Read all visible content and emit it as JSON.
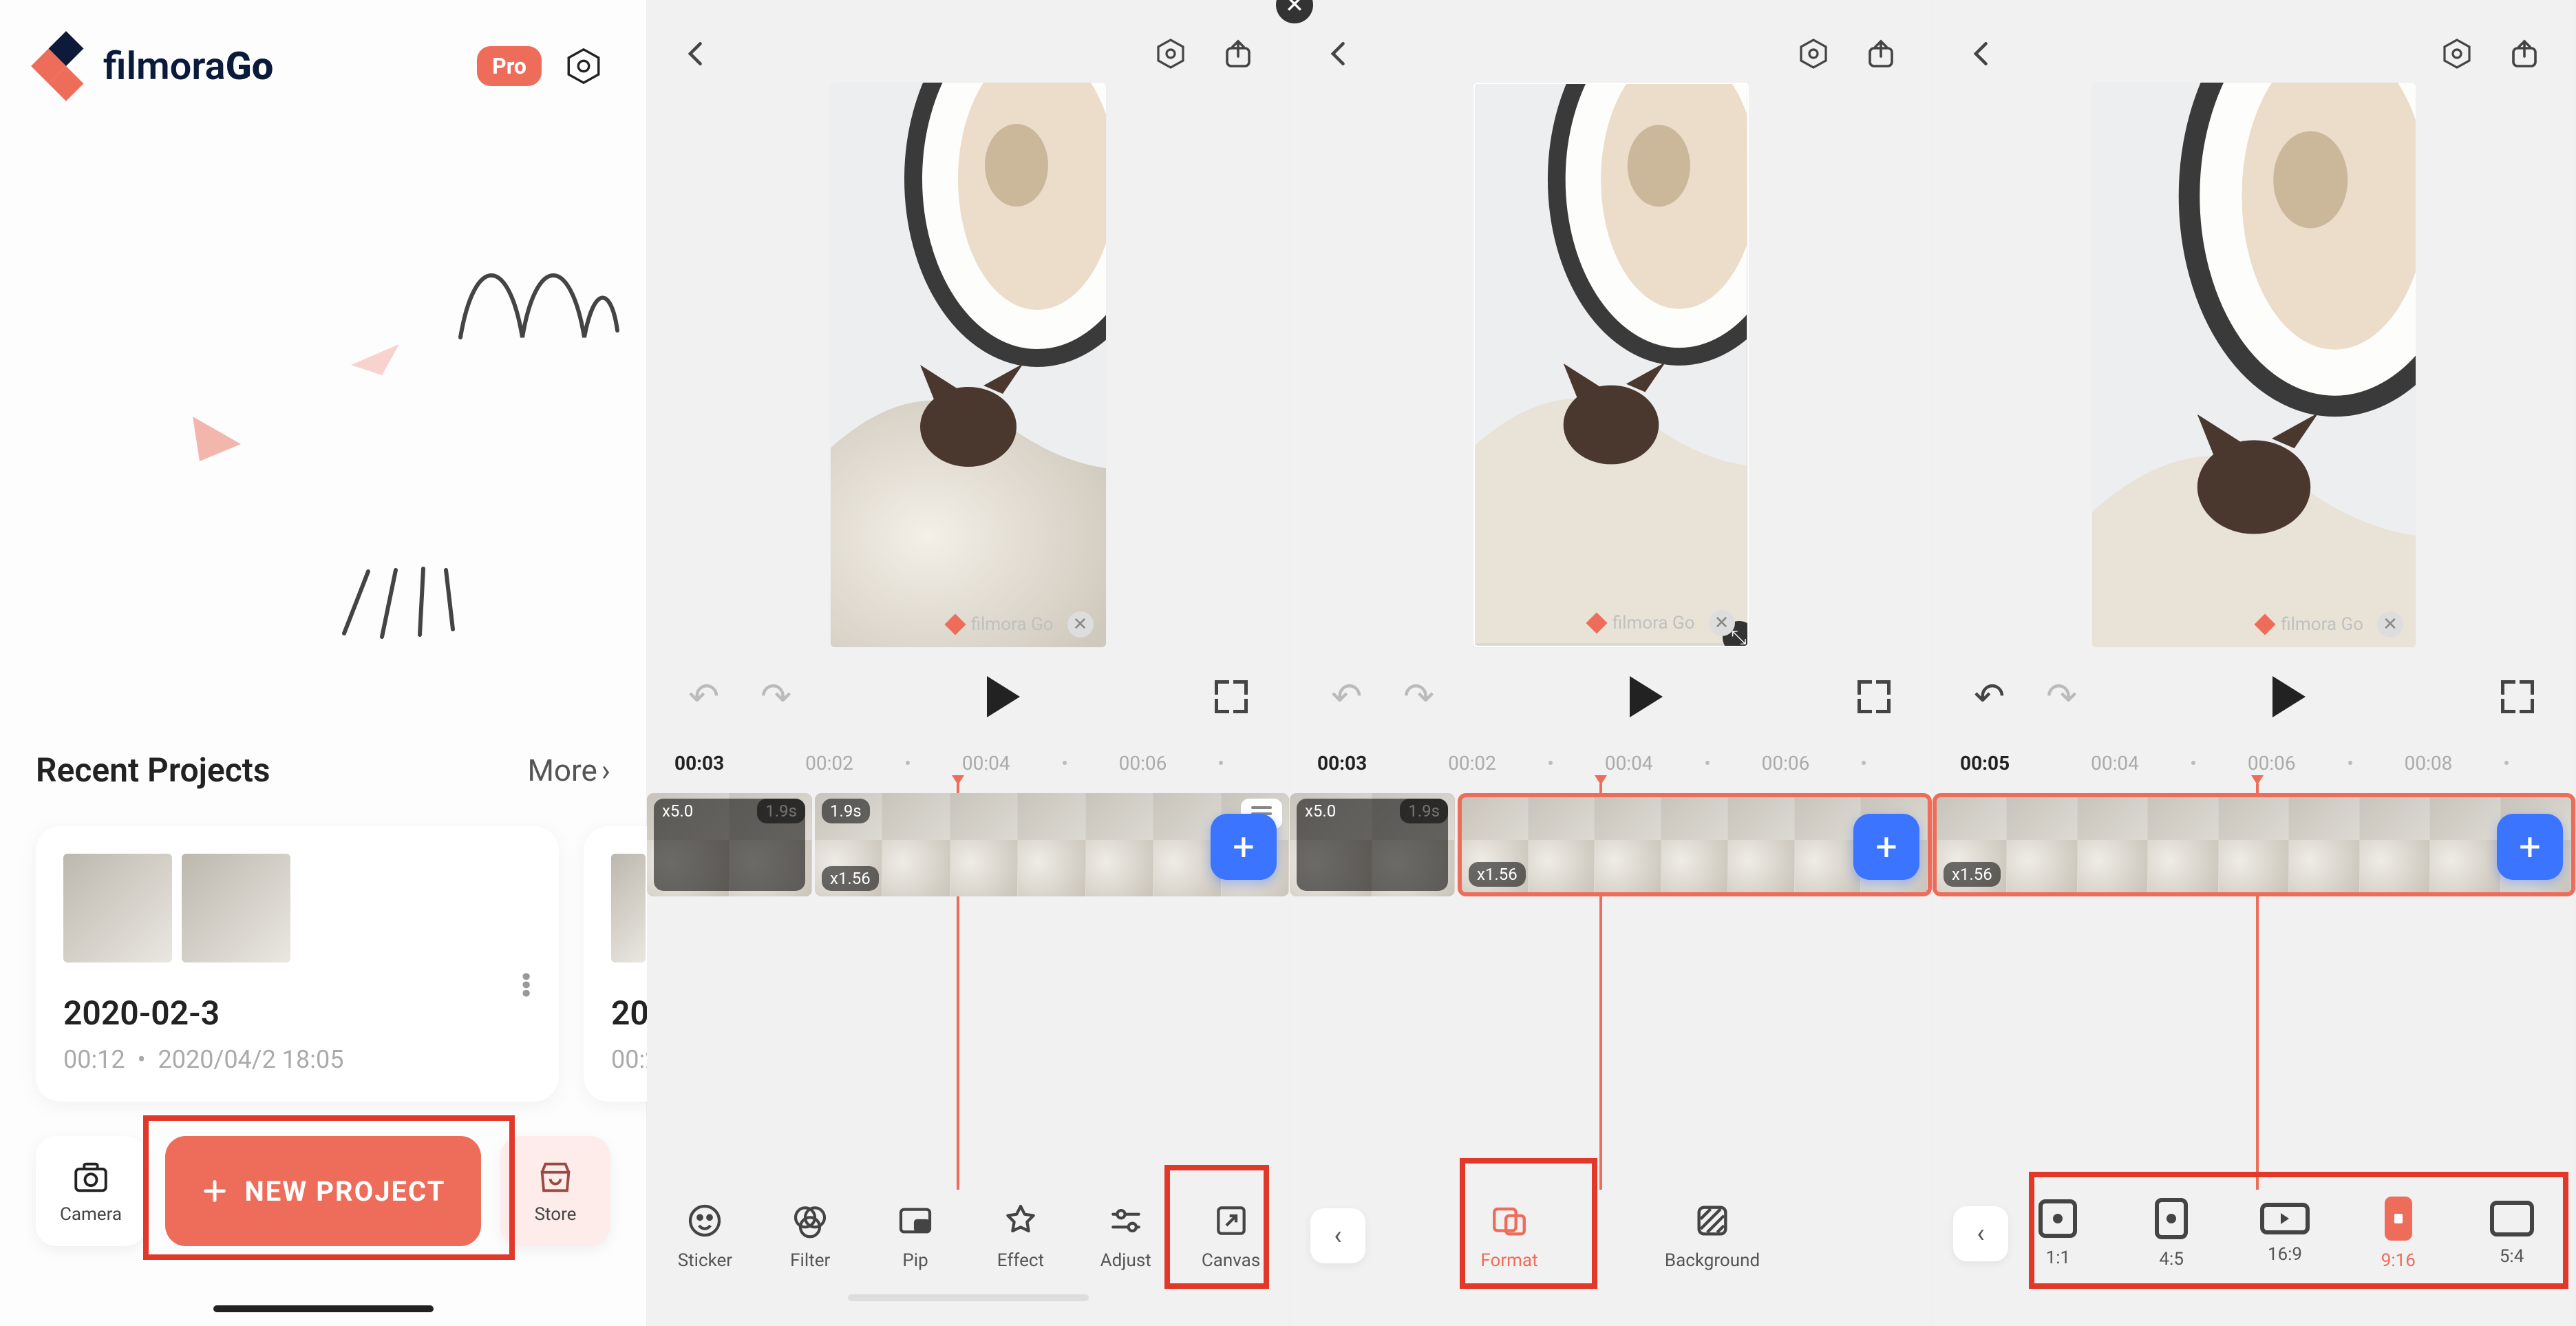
{
  "home": {
    "logo_text_plain": "filmora",
    "logo_text_bold": "Go",
    "pro_badge": "Pro",
    "recent_title": "Recent Projects",
    "more_label": "More",
    "project": {
      "name": "2020-02-3",
      "duration": "00:12",
      "sep": "•",
      "modified": "2020/04/2 18:05"
    },
    "project2_name_partial": "20",
    "project2_meta_partial": "00:2",
    "camera_label": "Camera",
    "new_project_label": "NEW PROJECT",
    "store_label": "Store"
  },
  "editor": {
    "watermark": "filmora Go",
    "tools": {
      "sticker": "Sticker",
      "filter": "Filter",
      "pip": "Pip",
      "effect": "Effect",
      "adjust": "Adjust",
      "canvas": "Canvas"
    },
    "canvas_sub": {
      "format": "Format",
      "background": "Background"
    },
    "aspect": {
      "r11": "1:1",
      "r45": "4:5",
      "r169": "16:9",
      "r916": "9:16",
      "r54": "5:4"
    },
    "clip_tags": {
      "dur1": "1.9s",
      "speed1": "x5.0",
      "dur2": "1.9s",
      "speed2": "x1.56"
    },
    "s2": {
      "time_current": "00:03",
      "ticks": [
        "00:02",
        "00:04",
        "00:06"
      ]
    },
    "s3": {
      "time_current": "00:03",
      "ticks": [
        "00:02",
        "00:04",
        "00:06"
      ]
    },
    "s4": {
      "time_current": "00:05",
      "ticks": [
        "00:04",
        "00:06",
        "00:08"
      ]
    }
  }
}
